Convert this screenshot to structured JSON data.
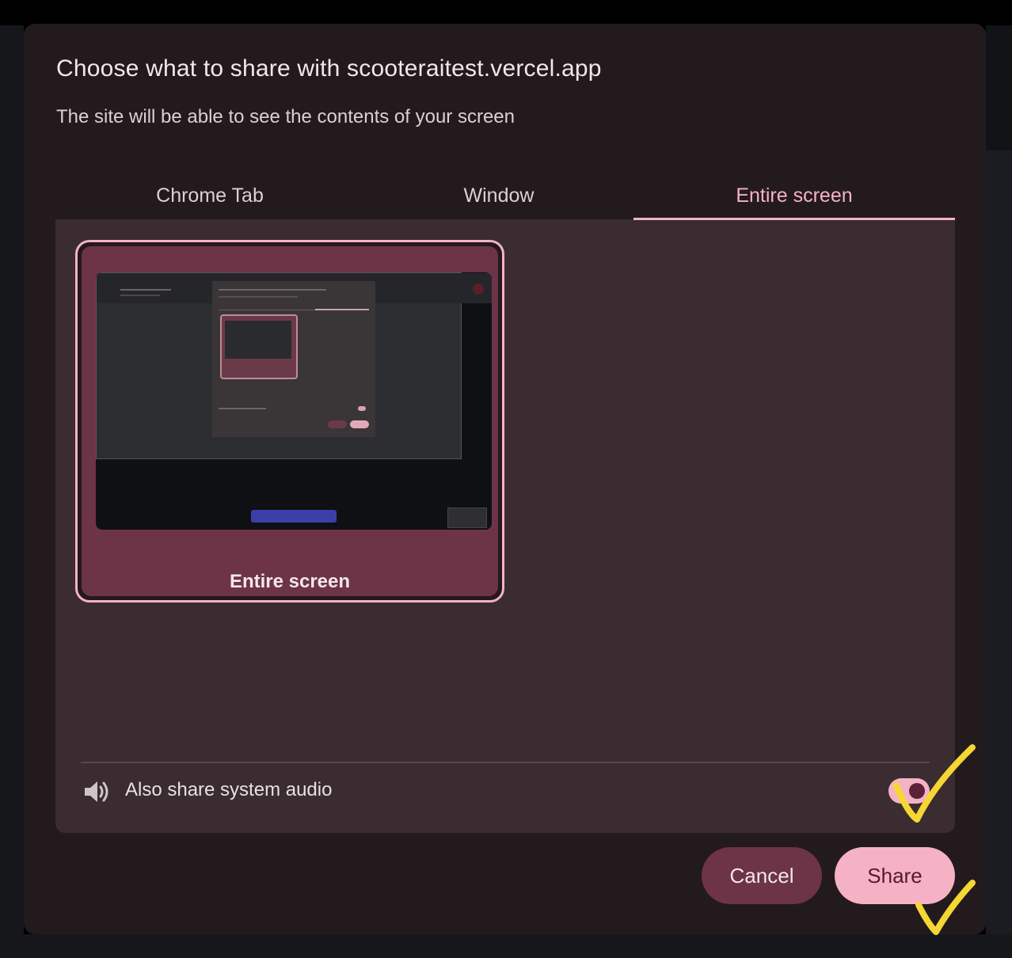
{
  "dialog": {
    "title": "Choose what to share with scooteraitest.vercel.app",
    "subtitle": "The site will be able to see the contents of your screen"
  },
  "tabs": [
    {
      "label": "Chrome Tab",
      "active": false
    },
    {
      "label": "Window",
      "active": false
    },
    {
      "label": "Entire screen",
      "active": true
    }
  ],
  "sources": [
    {
      "label": "Entire screen",
      "selected": true
    }
  ],
  "audio": {
    "label": "Also share system audio",
    "enabled": true,
    "icon": "speaker-icon"
  },
  "buttons": {
    "cancel": "Cancel",
    "share": "Share"
  },
  "colors": {
    "accent": "#f6b2c5",
    "dialog_bg": "#231a1e",
    "panel_bg": "#3a2c31",
    "selected_card": "#6d3346",
    "annotation": "#f5d633"
  }
}
